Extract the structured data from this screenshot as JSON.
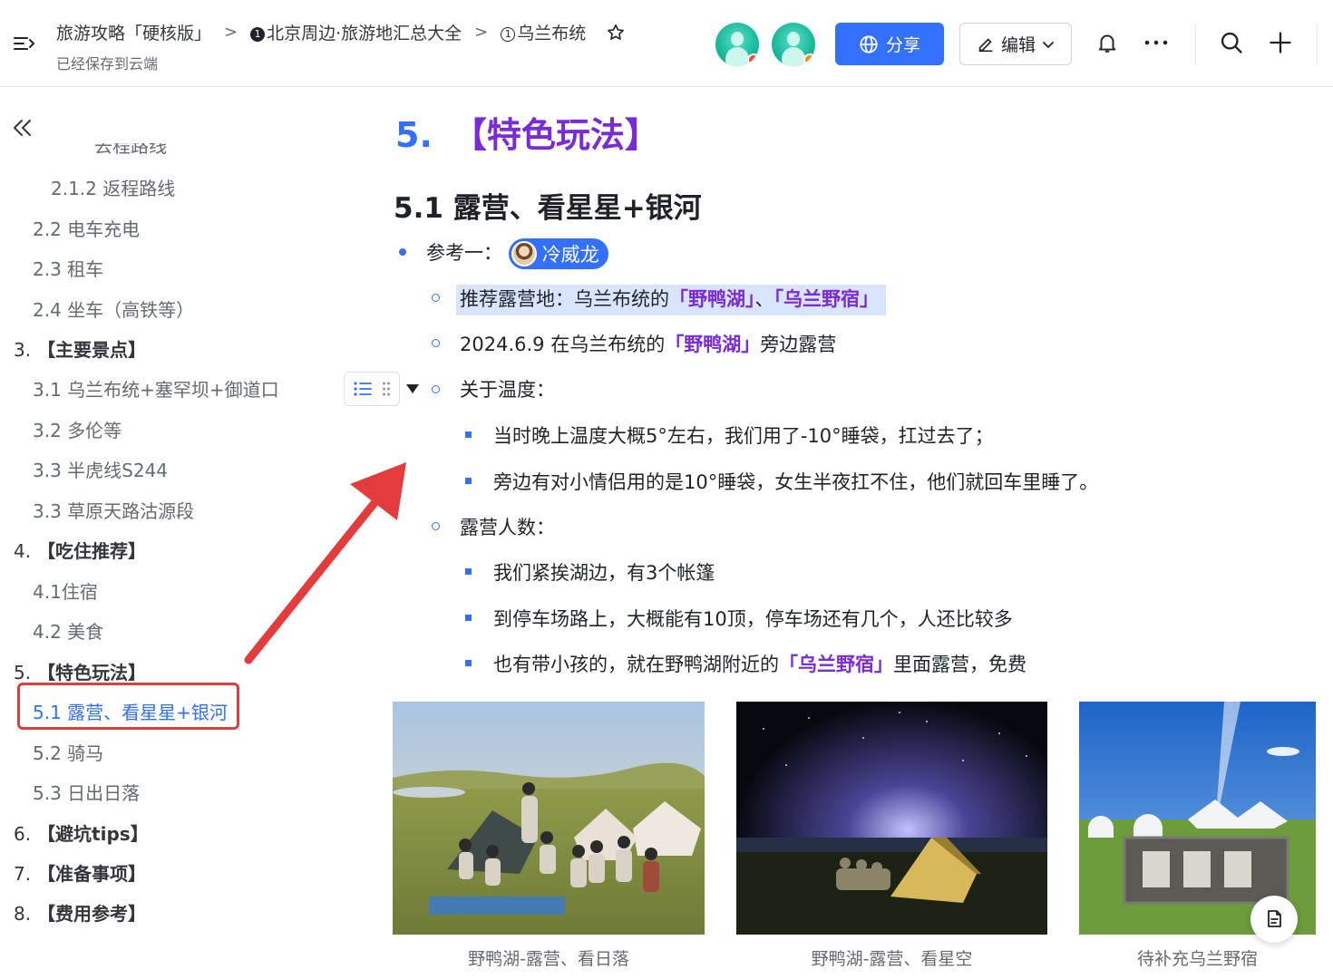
{
  "header": {
    "breadcrumbs": [
      {
        "label": "旅游攻略「硬核版」"
      },
      {
        "badge": "1",
        "label": "北京周边·旅游地汇总大全"
      },
      {
        "badge": "1",
        "label": "乌兰布统"
      }
    ],
    "saved_status": "已经保存到云端",
    "share_label": "分享",
    "edit_label": "编辑",
    "avatar_status_colors": [
      "#f54a45",
      "#ff8800"
    ],
    "accent_color": "#3370ff"
  },
  "toc": {
    "items": [
      {
        "label": "2.1.2 返程路线"
      },
      {
        "label": "2.2 电车充电"
      },
      {
        "label": "2.3 租车"
      },
      {
        "label": "2.4 坐车（高铁等）"
      },
      {
        "num": "3.",
        "label": "【主要景点】"
      },
      {
        "label": "3.1 乌兰布统+塞罕坝+御道口"
      },
      {
        "label": "3.2 多伦等"
      },
      {
        "label": "3.3 半虎线S244"
      },
      {
        "label": "3.3 草原天路沽源段"
      },
      {
        "num": "4.",
        "label": "【吃住推荐】"
      },
      {
        "label": "4.1住宿"
      },
      {
        "label": "4.2 美食"
      },
      {
        "num": "5.",
        "label": "【特色玩法】"
      },
      {
        "label": "5.1 露营、看星星+银河",
        "active": true
      },
      {
        "label": "5.2 骑马"
      },
      {
        "label": "5.3 日出日落"
      },
      {
        "num": "6.",
        "label": "【避坑tips】"
      },
      {
        "num": "7.",
        "label": "【准备事项】"
      },
      {
        "num": "8.",
        "label": "【费用参考】"
      }
    ]
  },
  "content": {
    "h1_num": "5.",
    "h1_title": "【特色玩法】",
    "h2": "5.1 露营、看星星+银河",
    "ref_label": "参考一：",
    "mention_name": "冷威龙",
    "rec_prefix": "推荐露营地：乌兰布统的",
    "rec_kw1": "「野鸭湖」",
    "rec_sep": "、",
    "rec_kw2": "「乌兰野宿」",
    "date_prefix": "2024.6.9 在乌兰布统的",
    "date_kw": "「野鸭湖」",
    "date_suffix": "旁边露营",
    "temp_label": "关于温度：",
    "temp_1": "当时晚上温度大概5°左右，我们用了-10°睡袋，扛过去了；",
    "temp_2": "旁边有对小情侣用的是10°睡袋，女生半夜扛不住，他们就回车里睡了。",
    "people_label": "露营人数：",
    "people_1": "我们紧挨湖边，有3个帐篷",
    "people_2": "到停车场路上，大概能有10顶，停车场还有几个，人还比较多",
    "people_3_prefix": "也有带小孩的，就在野鸭湖附近的",
    "people_3_kw": "「乌兰野宿」",
    "people_3_suffix": "里面露营，免费"
  },
  "gallery": [
    {
      "caption": "野鸭湖-露营、看日落"
    },
    {
      "caption": "野鸭湖-露营、看星空"
    },
    {
      "caption": "待补充乌兰野宿"
    }
  ]
}
